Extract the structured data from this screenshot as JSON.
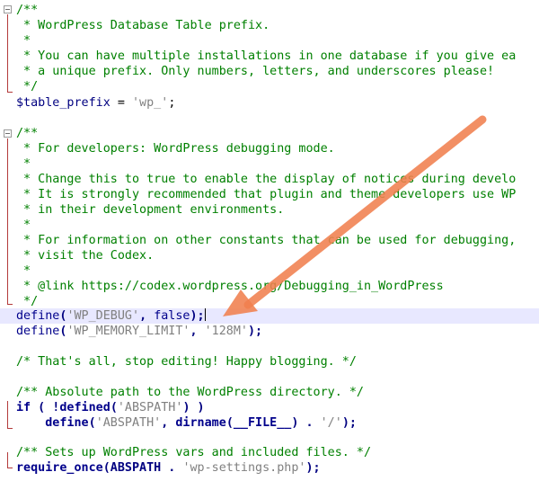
{
  "editor": {
    "block1": {
      "l1": "/**",
      "l2": " * WordPress Database Table prefix.",
      "l3": " *",
      "l4": " * You can have multiple installations in one database if you give ea",
      "l5": " * a unique prefix. Only numbers, letters, and underscores please!",
      "l6": " */",
      "var": "$table_prefix",
      "eq": " = ",
      "val": "'wp_'",
      "end": ";"
    },
    "block2": {
      "l1": "/**",
      "l2": " * For developers: WordPress debugging mode.",
      "l3": " *",
      "l4": " * Change this to true to enable the display of notices during develo",
      "l5": " * It is strongly recommended that plugin and theme developers use WP",
      "l6": " * in their development environments.",
      "l7": " *",
      "l8": " * For information on other constants that can be used for debugging,",
      "l9": " * visit the Codex.",
      "l10": " *",
      "l11": " * @link https://codex.wordpress.org/Debugging_in_WordPress",
      "l12": " */"
    },
    "define_debug": {
      "fn": "define",
      "open": "(",
      "arg1": "'WP_DEBUG'",
      "sep": ", ",
      "arg2": "false",
      "close": ");"
    },
    "define_memory": {
      "fn": "define",
      "open": "(",
      "arg1": "'WP_MEMORY_LIMIT'",
      "sep": ", ",
      "arg2": "'128M'",
      "close": ");"
    },
    "stop_comment": "/* That's all, stop editing! Happy blogging. */",
    "abs_comment": "/** Absolute path to the WordPress directory. */",
    "if_line": {
      "kw": "if",
      "p1": " ( !",
      "fn": "defined",
      "p2": "(",
      "arg": "'ABSPATH'",
      "p3": ") )"
    },
    "define_abspath": {
      "indent": "    ",
      "fn": "define",
      "p1": "(",
      "arg1": "'ABSPATH'",
      "p2": ", ",
      "fn2": "dirname",
      "p3": "(",
      "const": "__FILE__",
      "p4": ") . ",
      "arg3": "'/'",
      "p5": ");"
    },
    "settings_comment": "/** Sets up WordPress vars and included files. */",
    "require_line": {
      "kw": "require_once",
      "p1": "(ABSPATH . ",
      "arg": "'wp-settings.php'",
      "p2": ");"
    }
  },
  "colors": {
    "comment": "#008000",
    "string": "#808080",
    "keyword": "#00008b",
    "current_line": "#e8e8ff",
    "arrow": "#f07f4f"
  },
  "icons": {
    "fold_marker": "fold-collapse-icon",
    "pointer": "annotation-arrow"
  }
}
